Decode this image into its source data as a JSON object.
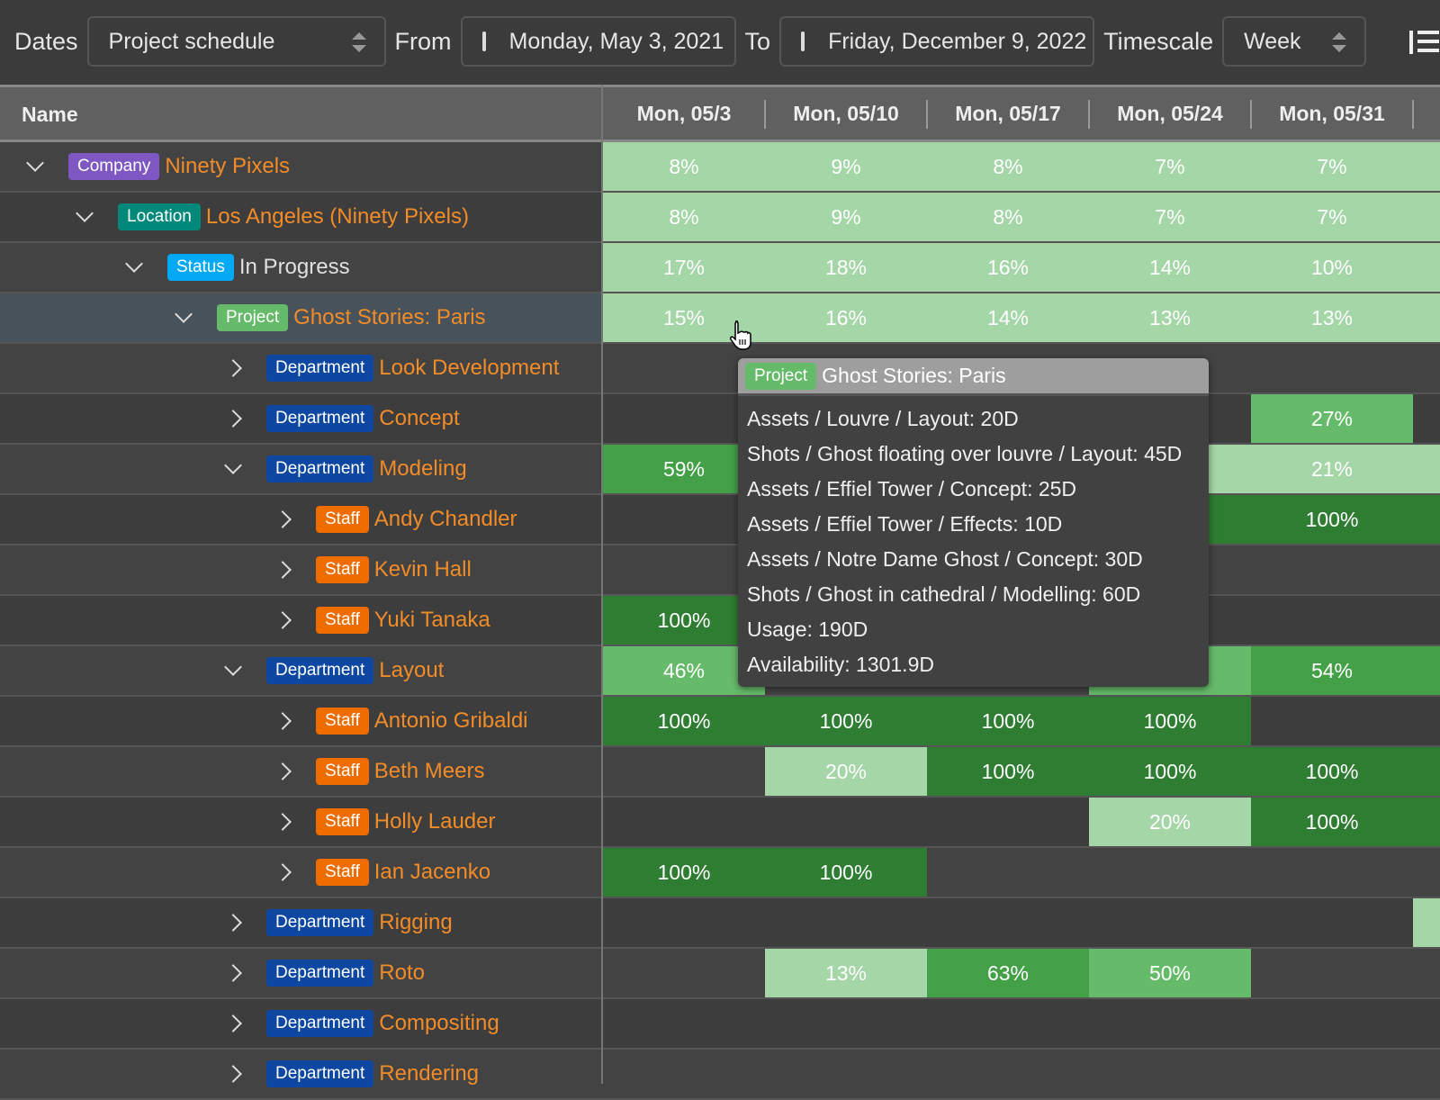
{
  "toolbar": {
    "dates_label": "Dates",
    "dates_value": "Project schedule",
    "from_label": "From",
    "from_value": "Monday, May 3, 2021",
    "to_label": "To",
    "to_value": "Friday, December 9, 2022",
    "timescale_label": "Timescale",
    "timescale_value": "Week"
  },
  "header": {
    "name": "Name",
    "columns": [
      "Mon, 05/3",
      "Mon, 05/10",
      "Mon, 05/17",
      "Mon, 05/24",
      "Mon, 05/31",
      ""
    ]
  },
  "colors": {
    "Company": "#7e57c2",
    "Location": "#00897b",
    "Status": "#03a9f4",
    "Project": "#66bb6a",
    "Department": "#0d47a1",
    "Staff": "#ef6c00",
    "light": "#a5d6a7",
    "mid": "#66bb6a",
    "strong": "#43a047",
    "dark": "#2e7d32"
  },
  "rows": [
    {
      "depth": 0,
      "open": true,
      "type": "Company",
      "name": "Ninety Pixels",
      "cells": [
        [
          "8%",
          "light"
        ],
        [
          "9%",
          "light"
        ],
        [
          "8%",
          "light"
        ],
        [
          "7%",
          "light"
        ],
        [
          "7%",
          "light"
        ],
        [
          "",
          "light"
        ]
      ]
    },
    {
      "depth": 1,
      "open": true,
      "type": "Location",
      "name": "Los Angeles (Ninety Pixels)",
      "cells": [
        [
          "8%",
          "light"
        ],
        [
          "9%",
          "light"
        ],
        [
          "8%",
          "light"
        ],
        [
          "7%",
          "light"
        ],
        [
          "7%",
          "light"
        ],
        [
          "",
          "light"
        ]
      ]
    },
    {
      "depth": 2,
      "open": true,
      "type": "Status",
      "name": "In Progress",
      "plain": true,
      "cells": [
        [
          "17%",
          "light"
        ],
        [
          "18%",
          "light"
        ],
        [
          "16%",
          "light"
        ],
        [
          "14%",
          "light"
        ],
        [
          "10%",
          "light"
        ],
        [
          "",
          "light"
        ]
      ]
    },
    {
      "depth": 3,
      "open": true,
      "type": "Project",
      "name": "Ghost Stories: Paris",
      "selected": true,
      "cells": [
        [
          "15%",
          "light"
        ],
        [
          "16%",
          "light"
        ],
        [
          "14%",
          "light"
        ],
        [
          "13%",
          "light"
        ],
        [
          "13%",
          "light"
        ],
        [
          "",
          "light"
        ]
      ]
    },
    {
      "depth": 4,
      "open": false,
      "type": "Department",
      "name": "Look Development",
      "cells": []
    },
    {
      "depth": 4,
      "open": false,
      "type": "Department",
      "name": "Concept",
      "cells": [
        null,
        null,
        null,
        null,
        [
          "27%",
          "mid"
        ]
      ]
    },
    {
      "depth": 4,
      "open": true,
      "type": "Department",
      "name": "Modeling",
      "cells": [
        [
          "59%",
          "strong"
        ],
        null,
        null,
        [
          "",
          "light"
        ],
        [
          "21%",
          "light"
        ],
        [
          "",
          "light"
        ]
      ]
    },
    {
      "depth": 5,
      "open": false,
      "type": "Staff",
      "name": "Andy Chandler",
      "cells": [
        null,
        null,
        null,
        [
          "",
          "dark"
        ],
        [
          "100%",
          "dark"
        ],
        [
          "",
          "dark"
        ]
      ]
    },
    {
      "depth": 5,
      "open": false,
      "type": "Staff",
      "name": "Kevin Hall",
      "cells": []
    },
    {
      "depth": 5,
      "open": false,
      "type": "Staff",
      "name": "Yuki Tanaka",
      "cells": [
        [
          "100%",
          "dark"
        ]
      ]
    },
    {
      "depth": 4,
      "open": true,
      "type": "Department",
      "name": "Layout",
      "cells": [
        [
          "46%",
          "mid"
        ],
        null,
        null,
        [
          "",
          "mid"
        ],
        [
          "54%",
          "strong"
        ],
        [
          "",
          "strong"
        ]
      ]
    },
    {
      "depth": 5,
      "open": false,
      "type": "Staff",
      "name": "Antonio Gribaldi",
      "cells": [
        [
          "100%",
          "dark"
        ],
        [
          "100%",
          "dark"
        ],
        [
          "100%",
          "dark"
        ],
        [
          "100%",
          "dark"
        ]
      ]
    },
    {
      "depth": 5,
      "open": false,
      "type": "Staff",
      "name": "Beth Meers",
      "cells": [
        null,
        [
          "20%",
          "light"
        ],
        [
          "100%",
          "dark"
        ],
        [
          "100%",
          "dark"
        ],
        [
          "100%",
          "dark"
        ],
        [
          "",
          "dark"
        ]
      ]
    },
    {
      "depth": 5,
      "open": false,
      "type": "Staff",
      "name": "Holly Lauder",
      "cells": [
        null,
        null,
        null,
        [
          "20%",
          "light"
        ],
        [
          "100%",
          "dark"
        ],
        [
          "",
          "dark"
        ]
      ]
    },
    {
      "depth": 5,
      "open": false,
      "type": "Staff",
      "name": "Ian Jacenko",
      "cells": [
        [
          "100%",
          "dark"
        ],
        [
          "100%",
          "dark"
        ]
      ]
    },
    {
      "depth": 4,
      "open": false,
      "type": "Department",
      "name": "Rigging",
      "cells": [
        null,
        null,
        null,
        null,
        null,
        [
          "",
          "light"
        ]
      ]
    },
    {
      "depth": 4,
      "open": false,
      "type": "Department",
      "name": "Roto",
      "cells": [
        null,
        [
          "13%",
          "light"
        ],
        [
          "63%",
          "strong"
        ],
        [
          "50%",
          "mid"
        ]
      ]
    },
    {
      "depth": 4,
      "open": false,
      "type": "Department",
      "name": "Compositing",
      "cells": []
    },
    {
      "depth": 4,
      "open": false,
      "type": "Department",
      "name": "Rendering",
      "cells": []
    }
  ],
  "tooltip": {
    "badge": "Project",
    "title": "Ghost Stories: Paris",
    "lines": [
      "Assets / Louvre / Layout: 20D",
      "Shots / Ghost floating over louvre / Layout: 45D",
      "Assets / Effiel Tower / Concept: 25D",
      "Assets / Effiel Tower / Effects: 10D",
      "Assets / Notre Dame Ghost / Concept: 30D",
      "Shots / Ghost in cathedral / Modelling: 60D",
      "Usage: 190D",
      "Availability: 1301.9D"
    ]
  }
}
